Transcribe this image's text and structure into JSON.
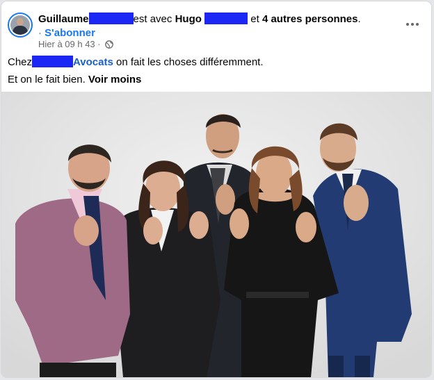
{
  "post": {
    "author_first": "Guillaume",
    "with_text": "est avec",
    "tagged_first": "Hugo",
    "connector": "et",
    "others": "4 autres personnes",
    "period": ".",
    "bullet": "·",
    "subscribe": "S'abonner",
    "time": "Hier à 09 h 43",
    "time_separator": "·",
    "privacy_icon": "globe-icon",
    "menu_icon": "more-options-icon"
  },
  "message": {
    "line1_prefix": "Chez",
    "firm_suffix": "Avocats",
    "line1_rest": "on fait les choses différemment.",
    "line2": "Et on le fait bien.",
    "see_less": "Voir moins"
  },
  "colors": {
    "link": "#1877f2",
    "redaction": "#1d27f5",
    "secondary_text": "#65676b",
    "backdrop": "#e6e6e6"
  }
}
